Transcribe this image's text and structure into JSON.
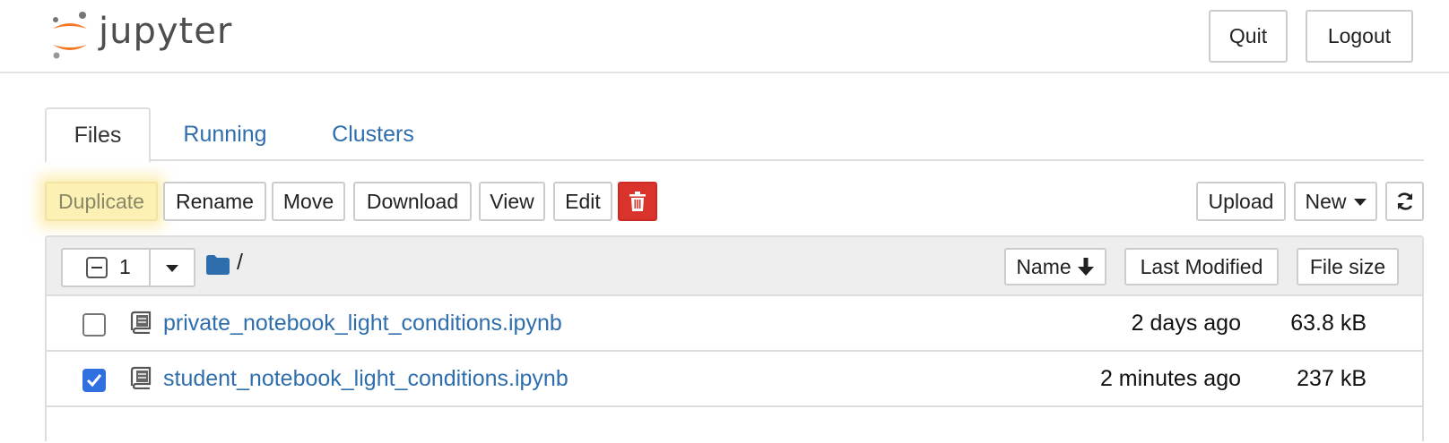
{
  "app": {
    "logo_text": "jupyter"
  },
  "header": {
    "quit_label": "Quit",
    "logout_label": "Logout"
  },
  "tabs": [
    {
      "label": "Files",
      "active": true
    },
    {
      "label": "Running",
      "active": false
    },
    {
      "label": "Clusters",
      "active": false
    }
  ],
  "toolbar": {
    "duplicate_label": "Duplicate",
    "rename_label": "Rename",
    "move_label": "Move",
    "download_label": "Download",
    "view_label": "View",
    "edit_label": "Edit",
    "delete_icon": "trash-icon",
    "upload_label": "Upload",
    "new_label": "New",
    "refresh_icon": "refresh-icon"
  },
  "list_header": {
    "selected_count": "1",
    "breadcrumb": "/",
    "sort_name_label": "Name",
    "sort_modified_label": "Last Modified",
    "sort_size_label": "File size"
  },
  "files": [
    {
      "name": "private_notebook_light_conditions.ipynb",
      "modified": "2 days ago",
      "size": "63.8 kB",
      "checked": false,
      "icon": "notebook-icon"
    },
    {
      "name": "student_notebook_light_conditions.ipynb",
      "modified": "2 minutes ago",
      "size": "237 kB",
      "checked": true,
      "icon": "notebook-icon"
    }
  ],
  "colors": {
    "link": "#2f6ead",
    "danger": "#d9342b",
    "checkbox_checked": "#2f6fdf",
    "highlight": "#fdf0b4",
    "logo_orange": "#f37726"
  }
}
